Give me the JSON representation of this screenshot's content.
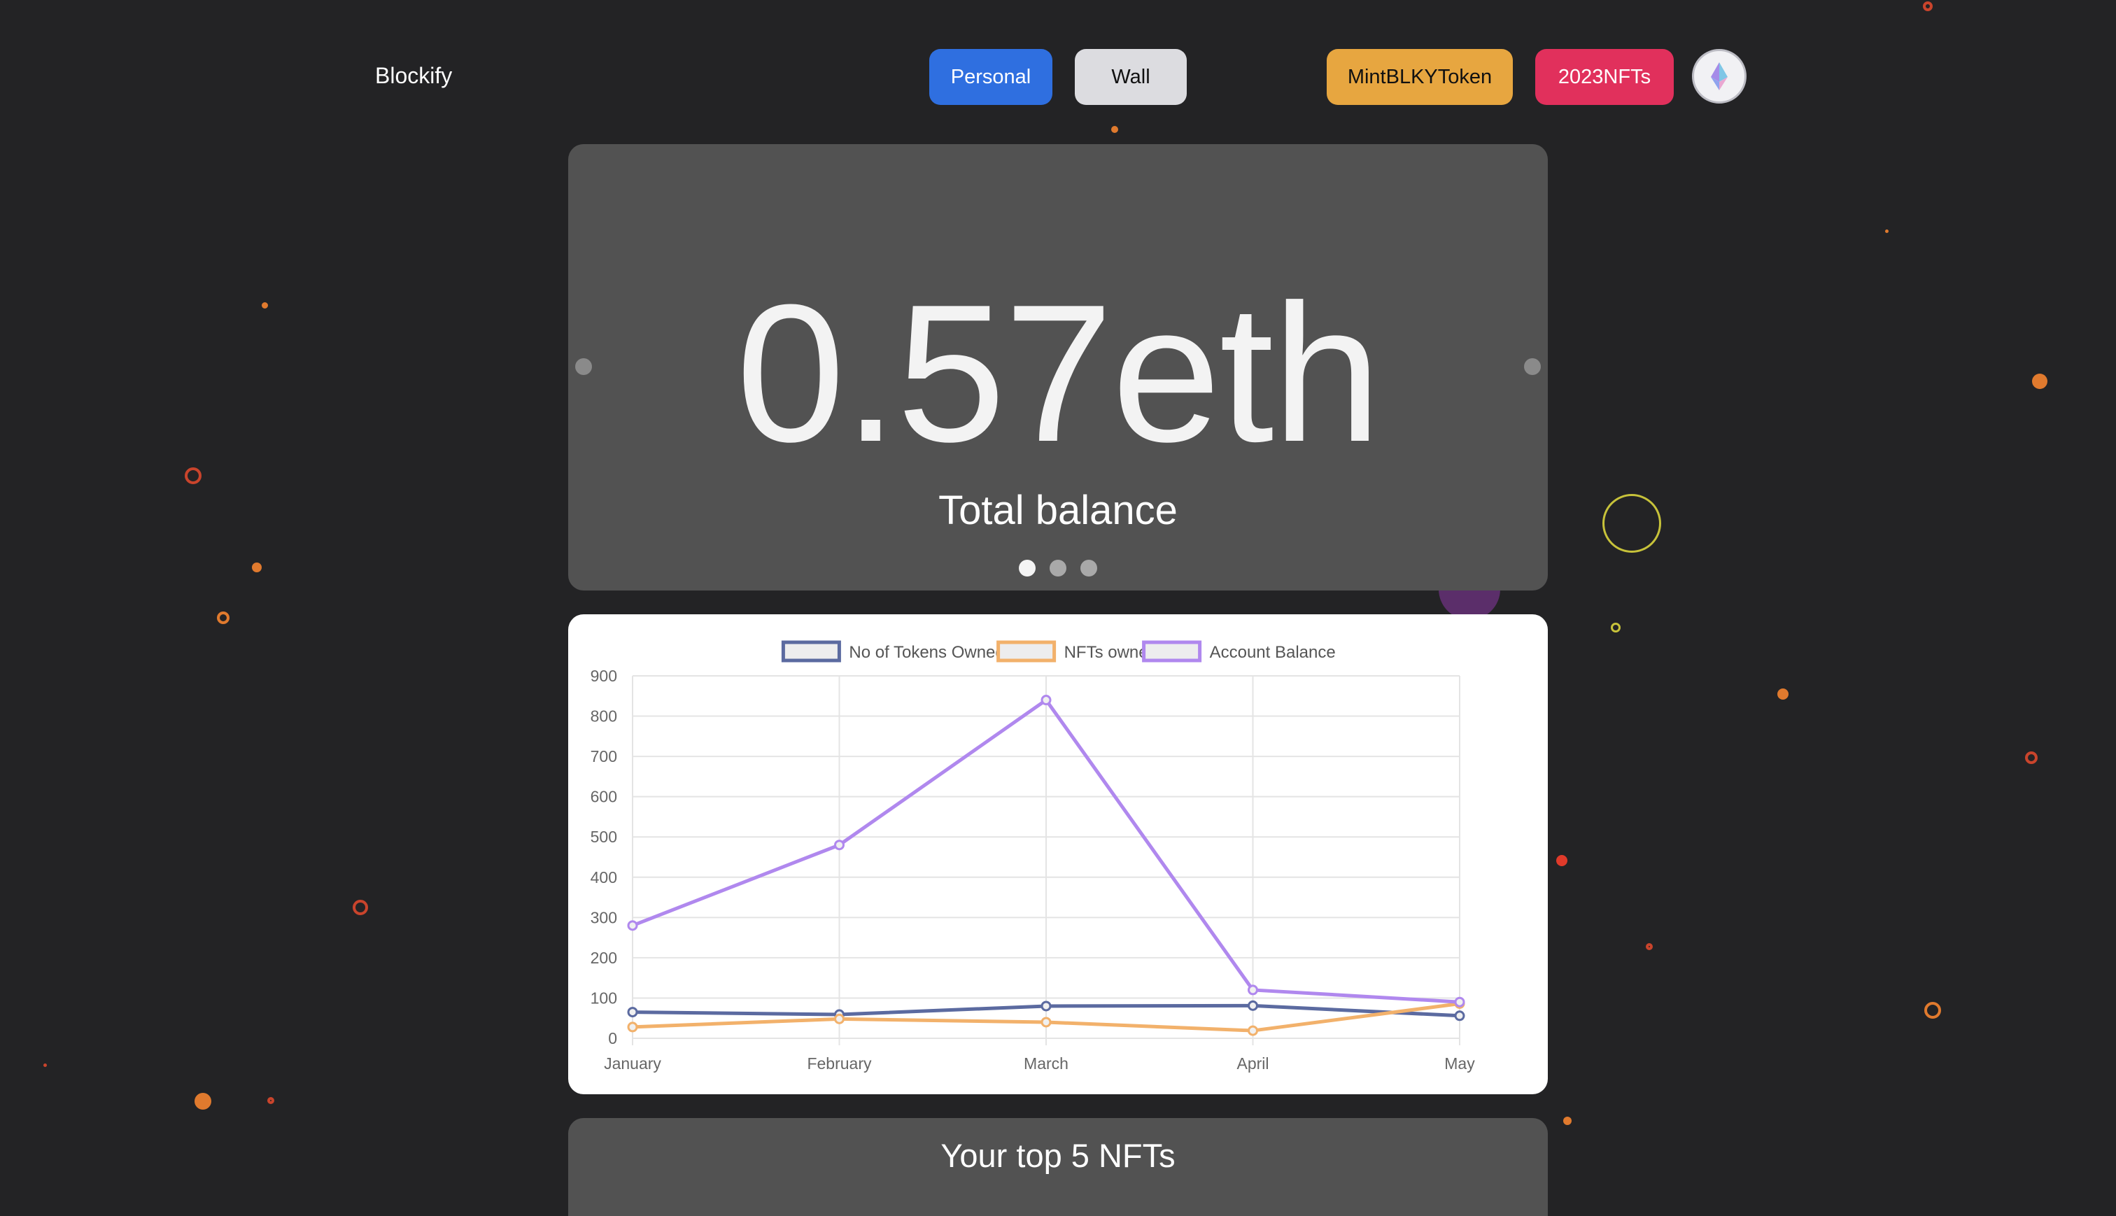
{
  "header": {
    "brand": "Blockify",
    "nav": {
      "personal_label": "Personal",
      "wall_label": "Wall",
      "mint_label": "MintBLKYToken",
      "nfts_label": "2023NFTs"
    },
    "avatar_icon": "ethereum-icon"
  },
  "balance_card": {
    "value": "0.57eth",
    "label": "Total balance",
    "active_slide": 1,
    "slide_count": 3
  },
  "chart_data": {
    "type": "line",
    "categories": [
      "January",
      "February",
      "March",
      "April",
      "May"
    ],
    "series": [
      {
        "name": "No of Tokens Owned",
        "values": [
          65,
          59,
          80,
          81,
          56
        ],
        "color": "#5b6aa0"
      },
      {
        "name": "NFTs owned",
        "values": [
          28,
          48,
          40,
          19,
          86
        ],
        "color": "#f2b16b"
      },
      {
        "name": "Account Balance",
        "values": [
          280,
          480,
          840,
          120,
          90
        ],
        "color": "#b088ee"
      }
    ],
    "ylim": [
      0,
      900
    ],
    "yticks": [
      "0",
      "100",
      "200",
      "300",
      "400",
      "500",
      "600",
      "700",
      "800",
      "900"
    ],
    "grid": true,
    "legend_position": "top"
  },
  "nft_section": {
    "title": "Your top 5 NFTs"
  },
  "colors": {
    "background": "#232325",
    "card": "#525252",
    "personal": "#2f6fe0",
    "wall": "#dcdce0",
    "mint": "#e7a640",
    "nfts": "#e1305c"
  }
}
